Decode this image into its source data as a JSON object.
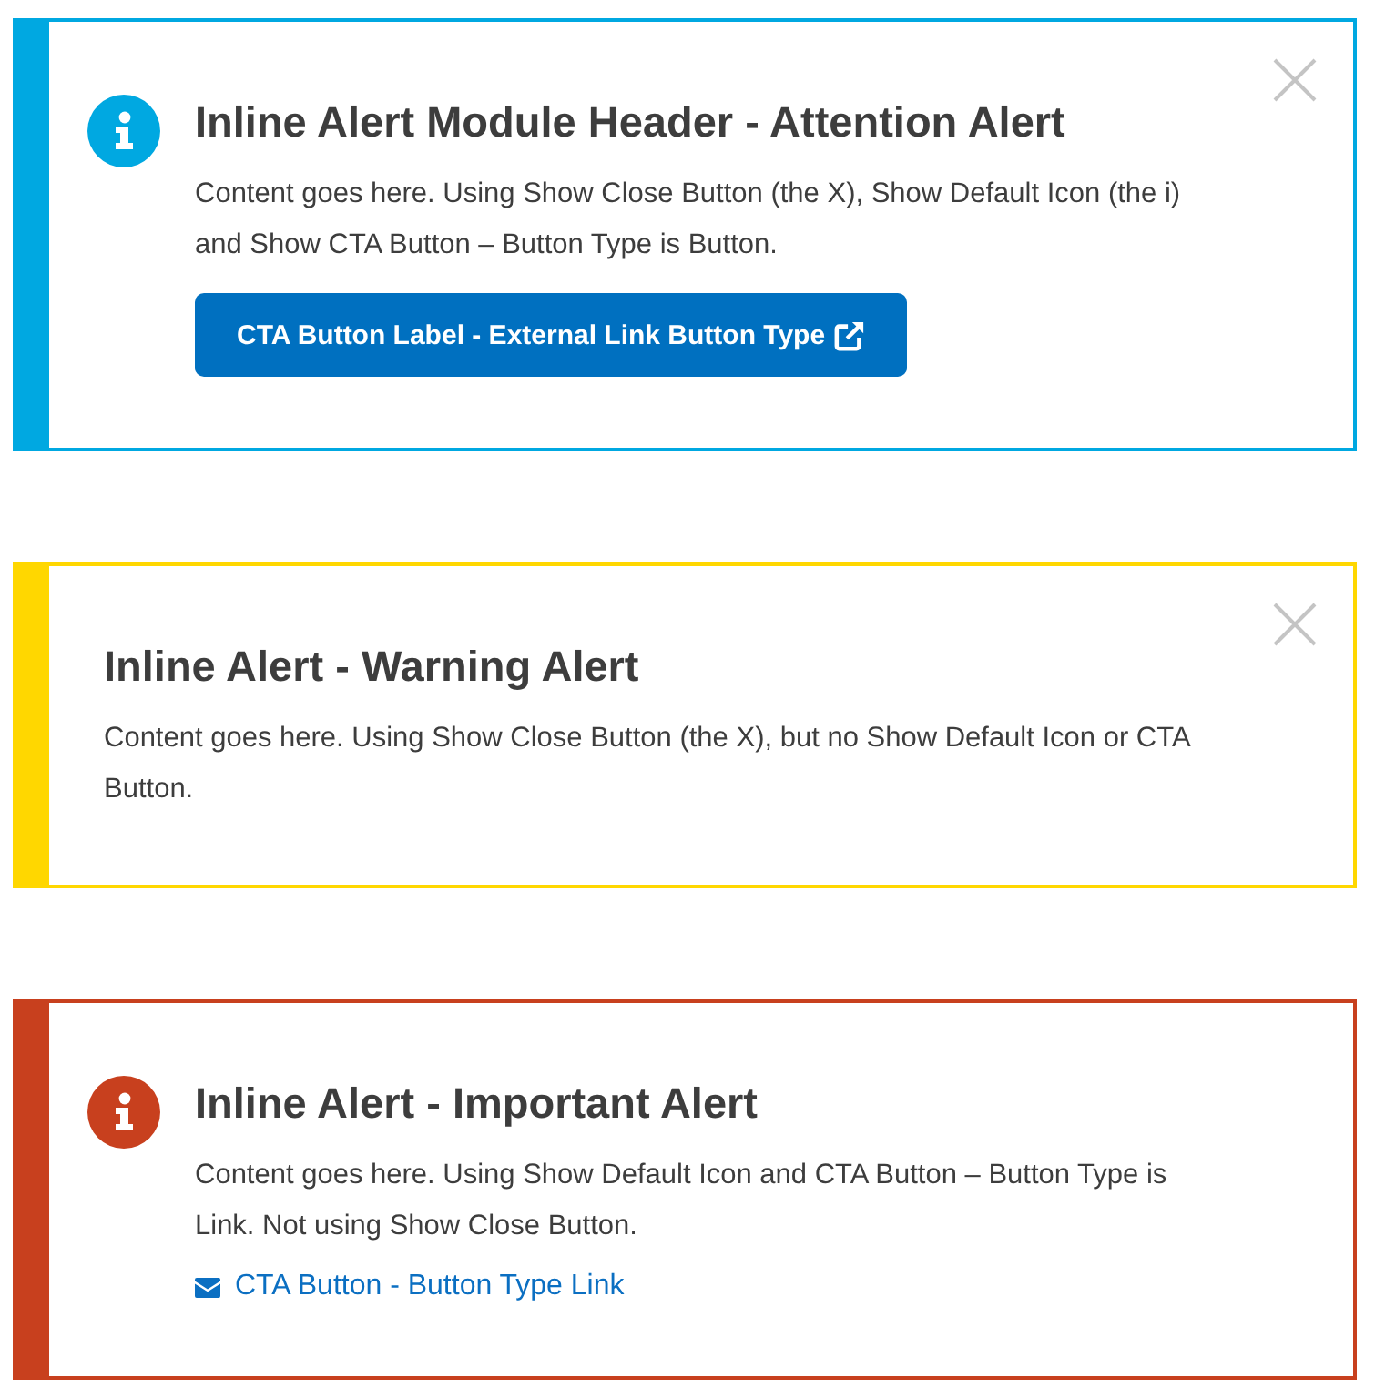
{
  "alerts": [
    {
      "color": "#00a8e1",
      "show_icon": true,
      "show_close": true,
      "title": "Inline Alert Module Header - Attention Alert",
      "body": "Content goes here. Using Show Close Button (the X), Show Default Icon (the i) and Show CTA Button – Button Type is Button.",
      "cta": {
        "kind": "button",
        "label": "CTA Button Label - External Link Button Type"
      }
    },
    {
      "color": "#ffd700",
      "show_icon": false,
      "show_close": true,
      "title": "Inline Alert - Warning Alert",
      "body": "Content goes here. Using Show Close Button (the X), but no Show Default Icon or CTA Button."
    },
    {
      "color": "#c8401e",
      "show_icon": true,
      "show_close": false,
      "title": "Inline Alert - Important Alert",
      "body": "Content goes here. Using Show Default Icon and CTA Button – Button Type is Link. Not using Show Close Button.",
      "cta": {
        "kind": "link",
        "label": "CTA Button - Button Type Link"
      }
    }
  ]
}
